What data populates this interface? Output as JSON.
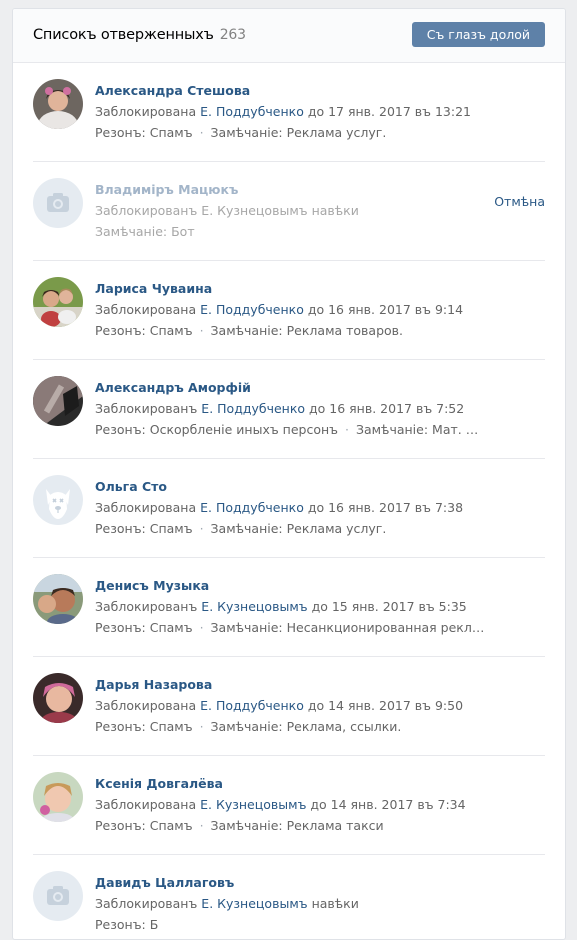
{
  "header": {
    "title": "Списокъ отверженныхъ",
    "count": "263",
    "button_label": "Съ глазъ долой"
  },
  "rows": [
    {
      "name": "Александра Стешова",
      "blocked_prefix": "Заблокирована",
      "blocker": "Е. Поддубченко",
      "until": "до 17 янв. 2017 въ 13:21",
      "reason_label": "Резонъ:",
      "reason": "Спамъ",
      "comment_label": "Замѣчаніе:",
      "comment": "Реклама услуг."
    },
    {
      "name": "Владиміръ Мацюкъ",
      "blocked_prefix": "Заблокированъ",
      "blocker": "Е. Кузнецовымъ",
      "until": "навѣки",
      "comment_label": "Замѣчаніе:",
      "comment": "Бот",
      "cancel_label": "Отмѣна"
    },
    {
      "name": "Лариса Чуваина",
      "blocked_prefix": "Заблокирована",
      "blocker": "Е. Поддубченко",
      "until": "до 16 янв. 2017 въ 9:14",
      "reason_label": "Резонъ:",
      "reason": "Спамъ",
      "comment_label": "Замѣчаніе:",
      "comment": "Реклама товаров."
    },
    {
      "name": "Александръ Аморфій",
      "blocked_prefix": "Заблокированъ",
      "blocker": "Е. Поддубченко",
      "until": "до 16 янв. 2017 въ 7:52",
      "reason_label": "Резонъ:",
      "reason": "Оскорбленіе иныхъ персонъ",
      "comment_label": "Замѣчаніе:",
      "comment": "Мат. Оскорбл..."
    },
    {
      "name": "Ольга Сто",
      "blocked_prefix": "Заблокирована",
      "blocker": "Е. Поддубченко",
      "until": "до 16 янв. 2017 въ 7:38",
      "reason_label": "Резонъ:",
      "reason": "Спамъ",
      "comment_label": "Замѣчаніе:",
      "comment": "Реклама услуг."
    },
    {
      "name": "Денисъ Музыка",
      "blocked_prefix": "Заблокированъ",
      "blocker": "Е. Кузнецовымъ",
      "until": "до 15 янв. 2017 въ 5:35",
      "reason_label": "Резонъ:",
      "reason": "Спамъ",
      "comment_label": "Замѣчаніе:",
      "comment": "Несанкционированная реклама"
    },
    {
      "name": "Дарья Назарова",
      "blocked_prefix": "Заблокирована",
      "blocker": "Е. Поддубченко",
      "until": "до 14 янв. 2017 въ 9:50",
      "reason_label": "Резонъ:",
      "reason": "Спамъ",
      "comment_label": "Замѣчаніе:",
      "comment": "Реклама, ссылки."
    },
    {
      "name": "Ксенія Довгалёва",
      "blocked_prefix": "Заблокирована",
      "blocker": "Е. Кузнецовымъ",
      "until": "до 14 янв. 2017 въ 7:34",
      "reason_label": "Резонъ:",
      "reason": "Спамъ",
      "comment_label": "Замѣчаніе:",
      "comment": "Реклама такси"
    },
    {
      "name": "Давидъ Цаллаговъ",
      "blocked_prefix": "Заблокированъ",
      "blocker": "Е. Кузнецовымъ",
      "until": "навѣки",
      "reason_label": "Резонъ:",
      "reason": "Б"
    }
  ]
}
